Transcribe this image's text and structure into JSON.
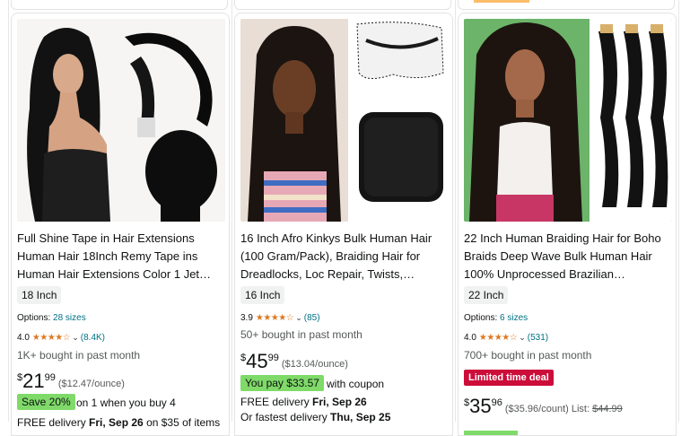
{
  "products": [
    {
      "title": "Full Shine Tape in Hair Extensions Human Hair 18Inch Remy Tape ins Human Hair Extensions Color 1 Jet…",
      "size": "18 Inch",
      "options_label": "Options:",
      "options_value": "28 sizes",
      "rating": "4.0",
      "review_count": "(8.4K)",
      "bought": "1K+ bought in past month",
      "price_symbol": "$",
      "price_whole": "21",
      "price_fraction": "99",
      "unit_price": "($12.47/ounce)",
      "promo_badge": "Save 20%",
      "promo_text": "on 1 when you buy 4",
      "delivery_prefix": "FREE delivery ",
      "delivery_date": "Fri, Sep 26",
      "delivery_suffix": " on $35 of items"
    },
    {
      "title": "16 Inch Afro Kinkys Bulk Human Hair (100 Gram/Pack), Braiding Hair for Dreadlocks, Loc Repair, Twists,…",
      "size": "16 Inch",
      "rating": "3.9",
      "review_count": "(85)",
      "bought": "50+ bought in past month",
      "price_symbol": "$",
      "price_whole": "45",
      "price_fraction": "99",
      "unit_price": "($13.04/ounce)",
      "coupon_badge": "You pay $33.57",
      "coupon_text": "with coupon",
      "delivery_prefix": "FREE delivery ",
      "delivery_date": "Fri, Sep 26",
      "fastest_prefix": "Or fastest delivery ",
      "fastest_date": "Thu, Sep 25"
    },
    {
      "title": "22 Inch Human Braiding Hair for Boho Braids Deep Wave Bulk Human Hair 100% Unprocessed Brazilian…",
      "size": "22 Inch",
      "options_label": "Options:",
      "options_value": "6 sizes",
      "rating": "4.0",
      "review_count": "(531)",
      "bought": "700+ bought in past month",
      "deal_badge": "Limited time deal",
      "price_symbol": "$",
      "price_whole": "35",
      "price_fraction": "96",
      "unit_price": "($35.96/count)",
      "list_label": "List:",
      "list_price": "$44.99"
    }
  ],
  "colors": {
    "link": "#007185",
    "star": "#de7921",
    "deal_red": "#cc0c39",
    "badge_green": "#7fda69"
  }
}
